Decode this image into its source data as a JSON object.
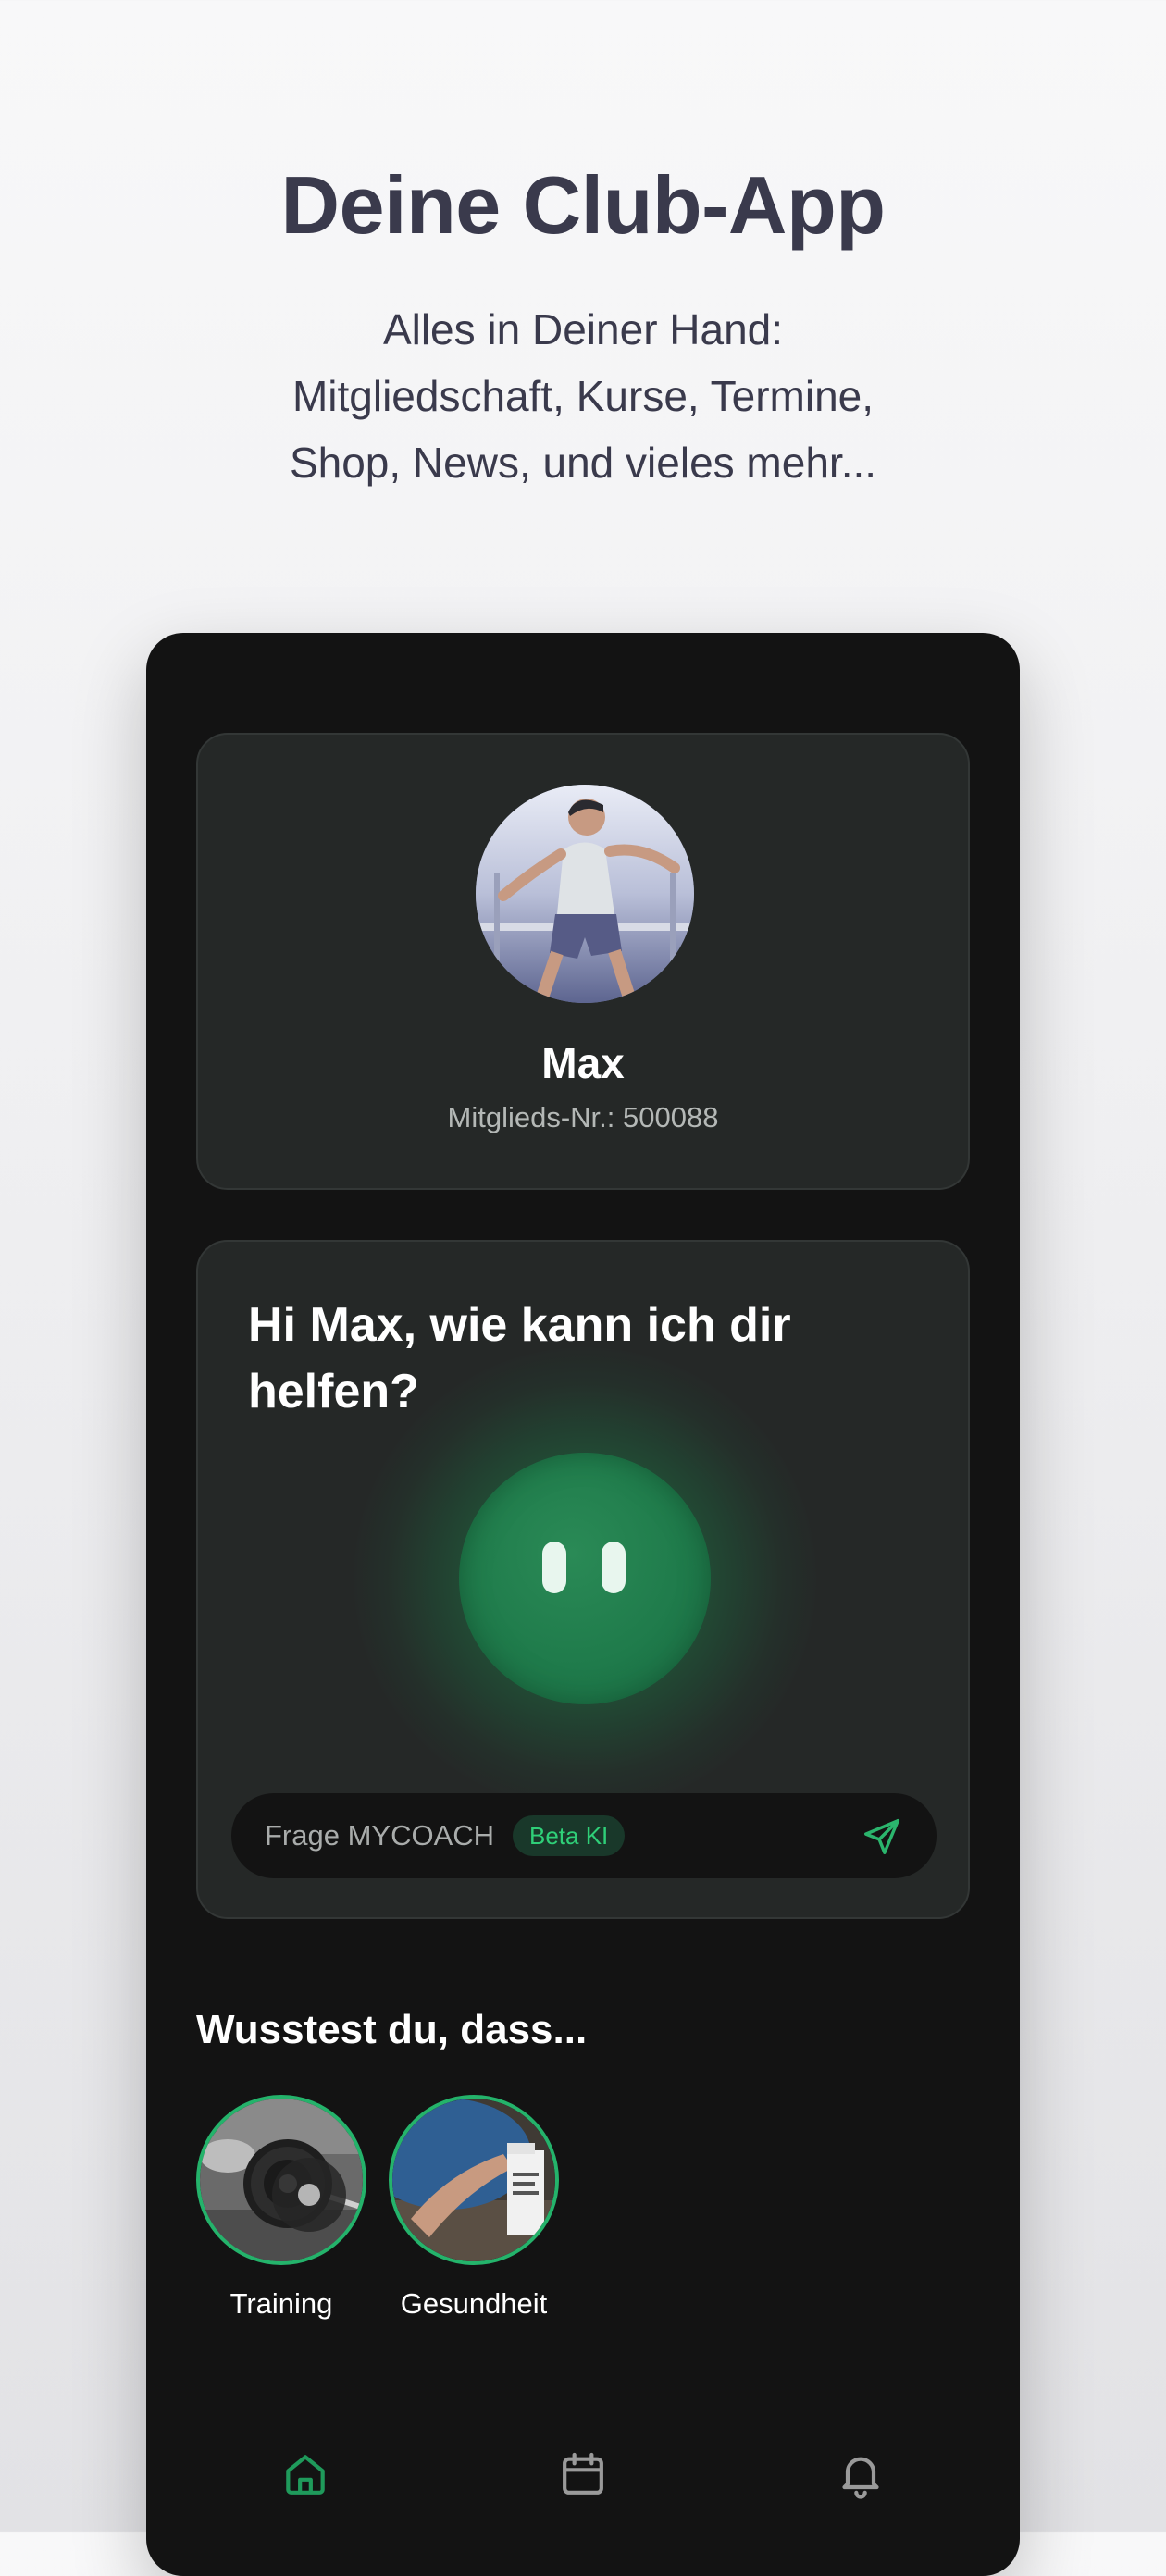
{
  "hero": {
    "title": "Deine Club-App",
    "subtitle_lines": [
      "Alles in Deiner Hand:",
      "Mitgliedschaft, Kurse, Termine,",
      "Shop, News, und vieles mehr..."
    ]
  },
  "profile": {
    "name": "Max",
    "member_number_label": "Mitglieds-Nr.: 500088"
  },
  "coach": {
    "greeting": "Hi Max, wie kann ich dir helfen?",
    "input_placeholder": "Frage MYCOACH",
    "badge": "Beta KI"
  },
  "tips": {
    "title": "Wusstest du, dass...",
    "stories": [
      {
        "label": "Training",
        "icon": "barbell-photo"
      },
      {
        "label": "Gesundheit",
        "icon": "health-photo"
      }
    ]
  },
  "bottom_nav": {
    "items": [
      {
        "icon": "home-icon",
        "active": true
      },
      {
        "icon": "calendar-icon",
        "active": false
      },
      {
        "icon": "bell-icon",
        "active": false
      }
    ]
  },
  "colors": {
    "accent": "#24b36b",
    "background_card": "#252827",
    "phone_background": "#131313",
    "hero_text": "#3a3a4c"
  }
}
